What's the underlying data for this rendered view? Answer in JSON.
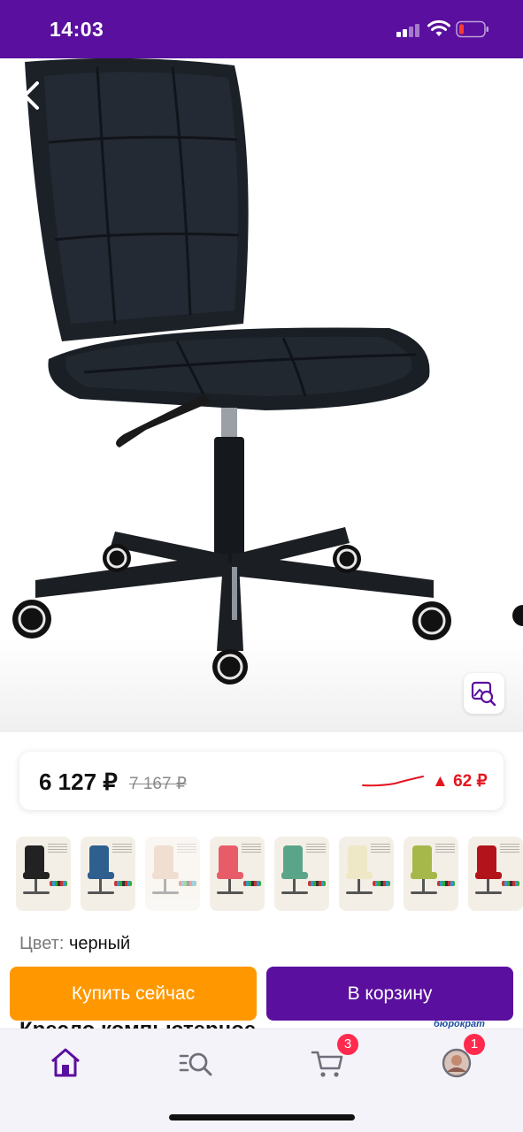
{
  "status": {
    "time": "14:03"
  },
  "price": {
    "current": "6 127 ₽",
    "old": "7 167 ₽",
    "delta": "62 ₽",
    "delta_direction": "up",
    "accent_color": "#e4151f"
  },
  "colors": {
    "brand": "#5a0f9e",
    "buy_now": "#ff9800",
    "badge": "#ff2a4d"
  },
  "variants": [
    {
      "color": "#222222",
      "selected": true
    },
    {
      "color": "#2e5f8f",
      "selected": false
    },
    {
      "color": "#e0b89a",
      "selected": false,
      "faded": true
    },
    {
      "color": "#e85c6a",
      "selected": false
    },
    {
      "color": "#5aa58a",
      "selected": false
    },
    {
      "color": "#efe8c6",
      "selected": false
    },
    {
      "color": "#a6b84a",
      "selected": false
    },
    {
      "color": "#b3141c",
      "selected": false
    }
  ],
  "color_selection": {
    "label": "Цвет:",
    "value": "черный"
  },
  "product": {
    "title_peek": "Кресло компьютерное",
    "brand": "бюрократ"
  },
  "actions": {
    "buy_now": "Купить сейчас",
    "add_to_cart": "В корзину"
  },
  "tabbar": {
    "items": [
      {
        "name": "home",
        "icon": "home-icon",
        "active": true
      },
      {
        "name": "catalog",
        "icon": "catalog-search-icon",
        "active": false
      },
      {
        "name": "cart",
        "icon": "cart-icon",
        "badge": "3"
      },
      {
        "name": "profile",
        "icon": "avatar",
        "badge": "1"
      }
    ]
  }
}
